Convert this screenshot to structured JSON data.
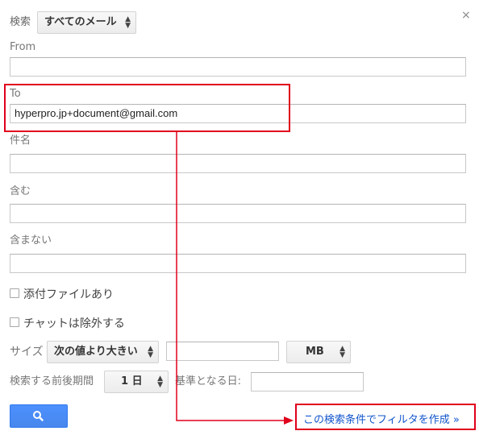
{
  "search": {
    "label": "検索",
    "scope_value": "すべてのメール"
  },
  "close_label": "×",
  "fields": {
    "from": {
      "label": "From",
      "value": ""
    },
    "to": {
      "label": "To",
      "value": "hyperpro.jp+document@gmail.com"
    },
    "subject": {
      "label": "件名",
      "value": ""
    },
    "has_words": {
      "label": "含む",
      "value": ""
    },
    "doesnt_have": {
      "label": "含まない",
      "value": ""
    }
  },
  "checkboxes": {
    "has_attachment": {
      "label": "添付ファイルあり",
      "checked": false
    },
    "exclude_chats": {
      "label": "チャットは除外する",
      "checked": false
    }
  },
  "size": {
    "label": "サイズ",
    "comparator": "次の値より大きい",
    "value": "",
    "unit": "MB"
  },
  "date_within": {
    "label": "検索する前後期間",
    "range": "1 日",
    "of_label": "基準となる日:",
    "value": ""
  },
  "create_filter_link": "この検索条件でフィルタを作成 »",
  "annotation_color": "#e0001b",
  "button_color": "#4d90fe"
}
